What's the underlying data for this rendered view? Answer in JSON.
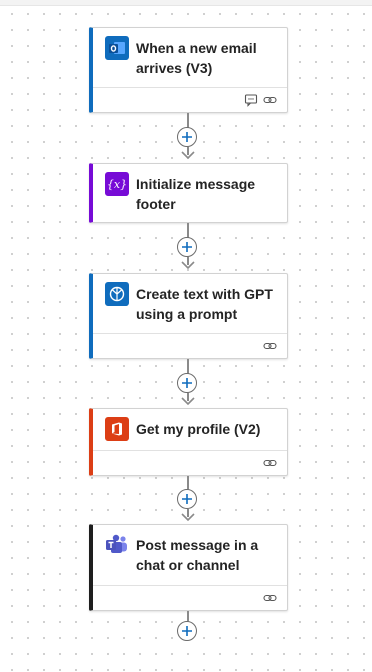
{
  "steps": [
    {
      "title": "When a new email arrives (V3)",
      "icon": "outlook-icon",
      "accent": "#0f6cbd",
      "footer_icons": [
        "comment-icon",
        "link-icon"
      ]
    },
    {
      "title": "Initialize message footer",
      "icon": "variable-icon",
      "accent": "#770bd6",
      "footer_icons": []
    },
    {
      "title": "Create text with GPT using a prompt",
      "icon": "ai-builder-icon",
      "accent": "#0f6cbd",
      "footer_icons": [
        "link-icon"
      ]
    },
    {
      "title": "Get my profile (V2)",
      "icon": "office365-icon",
      "accent": "#dc3e15",
      "footer_icons": [
        "link-icon"
      ]
    },
    {
      "title": "Post message in a chat or channel",
      "icon": "teams-icon",
      "accent": "#1e1e1e",
      "footer_icons": [
        "link-icon"
      ]
    }
  ],
  "connector_icon": "add-step-icon"
}
